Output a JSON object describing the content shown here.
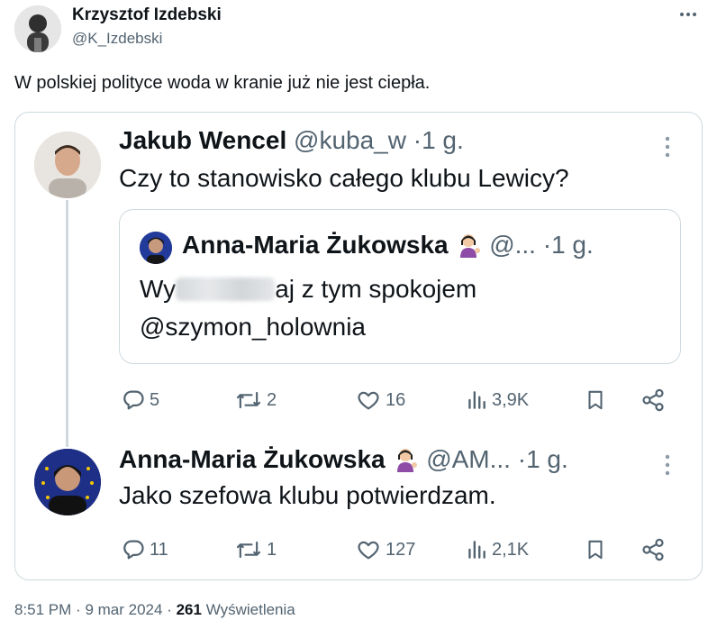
{
  "outer_tweet": {
    "author_name": "Krzysztof Izdebski",
    "author_handle": "@K_Izdebski",
    "text": "W polskiej polityce woda w kranie już nie jest ciepła.",
    "more_icon": "ellipsis-icon"
  },
  "reply_tweet": {
    "author_name": "Jakub Wencel",
    "author_handle": "@kuba_w",
    "separator": "·",
    "time": "1 g.",
    "text": "Czy to stanowisko całego klubu Lewicy?",
    "actions": {
      "replies": "5",
      "retweets": "2",
      "likes": "16",
      "views": "3,9K"
    }
  },
  "quoted_tweet": {
    "author_name": "Anna-Maria Żukowska",
    "author_handle": "@...",
    "separator": "·",
    "time": "1 g.",
    "text_start": "Wy",
    "text_end": "aj z tym spokojem",
    "mention": "@szymon_holownia"
  },
  "answer_tweet": {
    "author_name": "Anna-Maria Żukowska",
    "author_handle": "@AM...",
    "separator": "·",
    "time": "1 g.",
    "text": "Jako szefowa klubu potwierdzam.",
    "actions": {
      "replies": "11",
      "retweets": "1",
      "likes": "127",
      "views": "2,1K"
    }
  },
  "footer": {
    "time": "8:51 PM",
    "sep1": "·",
    "date": "9 mar 2024",
    "sep2": "·",
    "views_count": "261",
    "views_label": "Wyświetlenia"
  },
  "colors": {
    "text": "#0f1419",
    "muted": "#536471",
    "border": "#cfd9de"
  }
}
